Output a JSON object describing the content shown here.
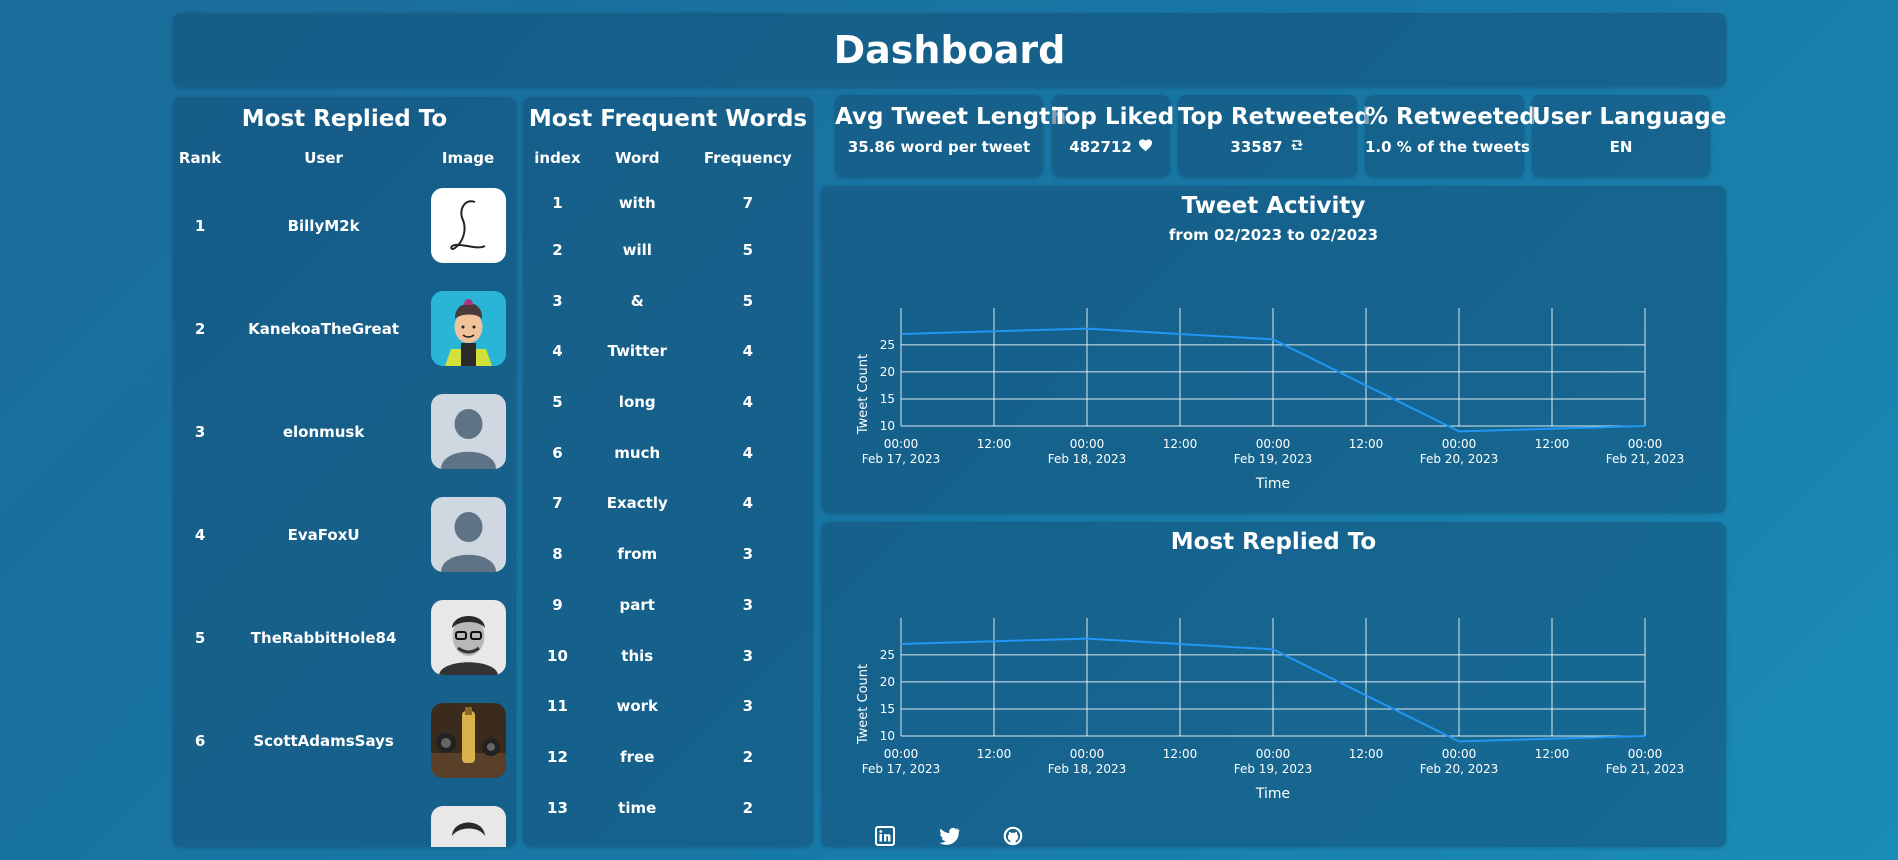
{
  "header": {
    "title": "Dashboard"
  },
  "most_replied": {
    "title": "Most Replied To",
    "columns": [
      "Rank",
      "User",
      "Image"
    ],
    "rows": [
      {
        "rank": "1",
        "user": "BillyM2k",
        "avatar": "script-l-avatar"
      },
      {
        "rank": "2",
        "user": "KanekoaTheGreat",
        "avatar": "cartoon-man-avatar"
      },
      {
        "rank": "3",
        "user": "elonmusk",
        "avatar": "default-avatar"
      },
      {
        "rank": "4",
        "user": "EvaFoxU",
        "avatar": "default-avatar"
      },
      {
        "rank": "5",
        "user": "TheRabbitHole84",
        "avatar": "glasses-man-photo-avatar"
      },
      {
        "rank": "6",
        "user": "ScottAdamsSays",
        "avatar": "bottle-photo-avatar"
      }
    ]
  },
  "frequent_words": {
    "title": "Most Frequent Words",
    "columns": [
      "index",
      "Word",
      "Frequency"
    ],
    "rows": [
      {
        "index": "1",
        "word": "with",
        "freq": "7"
      },
      {
        "index": "2",
        "word": "will",
        "freq": "5"
      },
      {
        "index": "3",
        "word": "&",
        "freq": "5"
      },
      {
        "index": "4",
        "word": "Twitter",
        "freq": "4"
      },
      {
        "index": "5",
        "word": "long",
        "freq": "4"
      },
      {
        "index": "6",
        "word": "much",
        "freq": "4"
      },
      {
        "index": "7",
        "word": "Exactly",
        "freq": "4"
      },
      {
        "index": "8",
        "word": "from",
        "freq": "3"
      },
      {
        "index": "9",
        "word": "part",
        "freq": "3"
      },
      {
        "index": "10",
        "word": "this",
        "freq": "3"
      },
      {
        "index": "11",
        "word": "work",
        "freq": "3"
      },
      {
        "index": "12",
        "word": "free",
        "freq": "2"
      },
      {
        "index": "13",
        "word": "time",
        "freq": "2"
      }
    ]
  },
  "stats": {
    "avg_title": "Avg Tweet Length",
    "avg_value": "35.86 word per tweet",
    "liked_title": "Top Liked",
    "liked_value": "482712",
    "liked_icon": "heart-icon",
    "rt_title": "Top Retweeted",
    "rt_value": "33587",
    "rt_icon": "retweet-icon",
    "pct_title": "% Retweeted",
    "pct_value": "1.0 % of the tweets",
    "lang_title": "User Language",
    "lang_value": "EN"
  },
  "chart_data": [
    {
      "type": "line",
      "title": "Tweet Activity",
      "subtitle": "from 02/2023 to 02/2023",
      "xlabel": "Time",
      "ylabel": "Tweet Count",
      "x": [
        "2023-02-17 00:00",
        "2023-02-18 00:00",
        "2023-02-19 00:00",
        "2023-02-20 00:00",
        "2023-02-21 00:00"
      ],
      "y": [
        27,
        28,
        26,
        9,
        10
      ],
      "ylim": [
        10,
        27
      ],
      "yticks": [
        10,
        15,
        20,
        25
      ],
      "xticks": [
        [
          "00:00",
          "Feb 17, 2023"
        ],
        [
          "12:00",
          ""
        ],
        [
          "00:00",
          "Feb 18, 2023"
        ],
        [
          "12:00",
          ""
        ],
        [
          "00:00",
          "Feb 19, 2023"
        ],
        [
          "12:00",
          ""
        ],
        [
          "00:00",
          "Feb 20, 2023"
        ],
        [
          "12:00",
          ""
        ],
        [
          "00:00",
          "Feb 21, 2023"
        ]
      ],
      "grid": true,
      "line_color": "#2196f3"
    },
    {
      "type": "line",
      "title": "Most Replied To",
      "subtitle": "",
      "xlabel": "Time",
      "ylabel": "Tweet Count",
      "x": [
        "2023-02-17 00:00",
        "2023-02-18 00:00",
        "2023-02-19 00:00",
        "2023-02-20 00:00",
        "2023-02-21 00:00"
      ],
      "y": [
        27,
        28,
        26,
        9,
        10
      ],
      "ylim": [
        10,
        27
      ],
      "yticks": [
        10,
        15,
        20,
        25
      ],
      "xticks": [
        [
          "00:00",
          "Feb 17, 2023"
        ],
        [
          "12:00",
          ""
        ],
        [
          "00:00",
          "Feb 18, 2023"
        ],
        [
          "12:00",
          ""
        ],
        [
          "00:00",
          "Feb 19, 2023"
        ],
        [
          "12:00",
          ""
        ],
        [
          "00:00",
          "Feb 20, 2023"
        ],
        [
          "12:00",
          ""
        ],
        [
          "00:00",
          "Feb 21, 2023"
        ]
      ],
      "grid": true,
      "line_color": "#2196f3"
    }
  ],
  "social": [
    {
      "icon": "linkedin-icon"
    },
    {
      "icon": "twitter-icon"
    },
    {
      "icon": "github-icon"
    }
  ]
}
